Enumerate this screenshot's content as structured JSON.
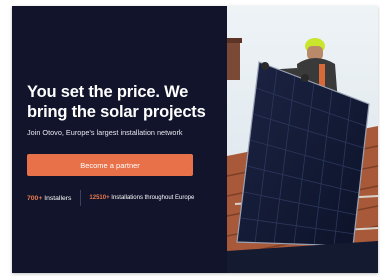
{
  "hero": {
    "headline_line1": "You set the price. We",
    "headline_line2": "bring the solar projects",
    "subtitle": "Join Otovo, Europe's largest installation network",
    "cta_label": "Become a partner"
  },
  "stats": [
    {
      "number": "700+",
      "label": " Installers"
    },
    {
      "number": "12510+",
      "label": " Installations throughout Europe"
    }
  ],
  "colors": {
    "background": "#11142a",
    "accent": "#e8714a",
    "text": "#ffffff"
  },
  "image": {
    "icon": "solar-installer-photo"
  }
}
